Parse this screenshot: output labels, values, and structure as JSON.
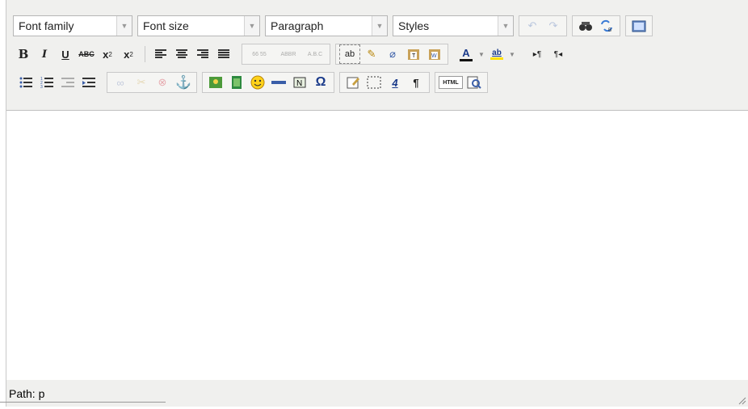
{
  "toolbar": {
    "font_family": "Font family",
    "font_size": "Font size",
    "format": "Paragraph",
    "styles": "Styles",
    "bold": "B",
    "italic": "I",
    "underline": "U",
    "strike": "ABC",
    "subscript": "x",
    "superscript": "x",
    "forecolor": "A",
    "backcolor": "ab",
    "html_button": "HTML",
    "pilcrow": "¶",
    "omega": "Ω"
  },
  "statusbar": {
    "path": "Path: p"
  },
  "icons": [
    "undo-icon",
    "redo-icon",
    "find-icon",
    "replace-icon",
    "fullscreen-icon",
    "justify-left-icon",
    "justify-center-icon",
    "justify-right-icon",
    "justify-full-icon",
    "cite-icon",
    "abbr-icon",
    "acronym-icon",
    "spellcheck-icon",
    "cleanup-icon",
    "removeformat-icon",
    "paste-text-icon",
    "paste-word-icon",
    "bullet-list-icon",
    "numbered-list-icon",
    "outdent-icon",
    "indent-icon",
    "link-icon",
    "unlink-icon",
    "del-icon",
    "anchor-icon",
    "image-icon",
    "media-icon",
    "emoticon-icon",
    "hr-icon",
    "nonbreaking-icon",
    "charmap-icon",
    "template-icon",
    "visualaid-icon",
    "styleprops-icon",
    "visualchars-icon",
    "code-icon",
    "preview-icon"
  ]
}
